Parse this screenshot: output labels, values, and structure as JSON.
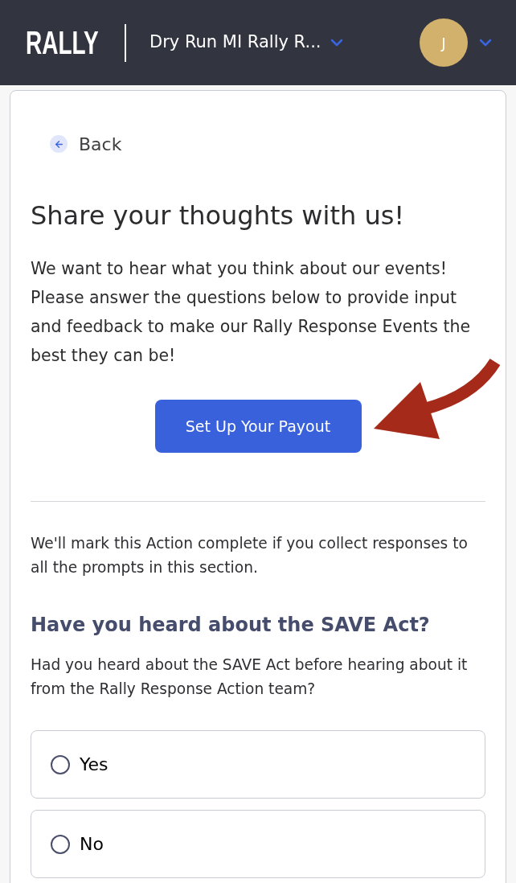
{
  "header": {
    "logo": "RALLY",
    "campaign": "Dry Run MI Rally R...",
    "avatar_initial": "J"
  },
  "back": {
    "label": "Back"
  },
  "title": "Share your thoughts with us!",
  "intro": "We want to hear what you think about our events! Please answer the questions below to provide input and feedback to make our Rally Response Events the best they can be!",
  "payout_button": {
    "label": "Set Up Your Payout"
  },
  "completion_note": "We'll mark this Action complete if you collect responses to all the prompts in this section.",
  "question": {
    "title": "Have you heard about the SAVE Act?",
    "description": "Had you heard about the SAVE Act before hearing about it from the Rally Response Action team?",
    "options": [
      {
        "label": "Yes",
        "selected": false
      },
      {
        "label": "No",
        "selected": false
      }
    ]
  }
}
